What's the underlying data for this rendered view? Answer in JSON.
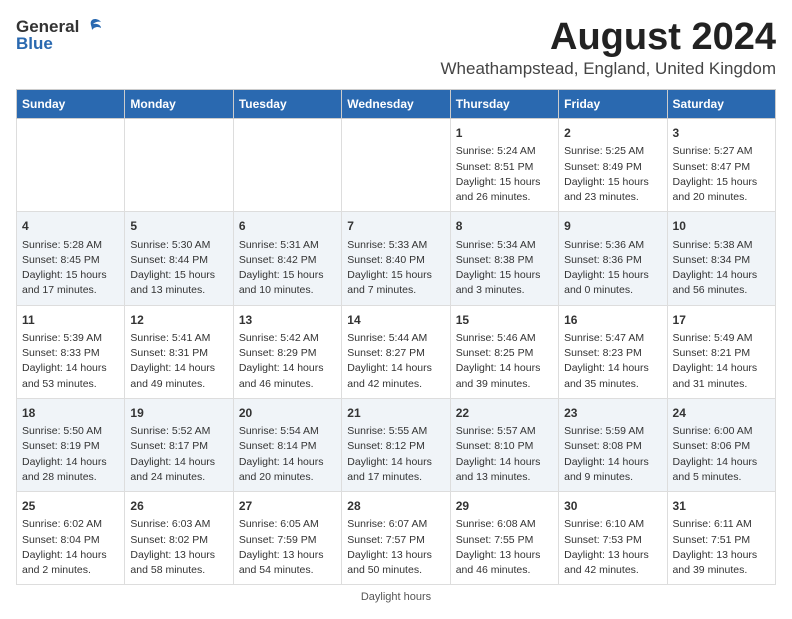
{
  "logo": {
    "general": "General",
    "blue": "Blue"
  },
  "title": "August 2024",
  "subtitle": "Wheathampstead, England, United Kingdom",
  "days_of_week": [
    "Sunday",
    "Monday",
    "Tuesday",
    "Wednesday",
    "Thursday",
    "Friday",
    "Saturday"
  ],
  "footer": "Daylight hours",
  "weeks": [
    [
      {
        "day": "",
        "data": ""
      },
      {
        "day": "",
        "data": ""
      },
      {
        "day": "",
        "data": ""
      },
      {
        "day": "",
        "data": ""
      },
      {
        "day": "1",
        "data": "Sunrise: 5:24 AM\nSunset: 8:51 PM\nDaylight: 15 hours\nand 26 minutes."
      },
      {
        "day": "2",
        "data": "Sunrise: 5:25 AM\nSunset: 8:49 PM\nDaylight: 15 hours\nand 23 minutes."
      },
      {
        "day": "3",
        "data": "Sunrise: 5:27 AM\nSunset: 8:47 PM\nDaylight: 15 hours\nand 20 minutes."
      }
    ],
    [
      {
        "day": "4",
        "data": "Sunrise: 5:28 AM\nSunset: 8:45 PM\nDaylight: 15 hours\nand 17 minutes."
      },
      {
        "day": "5",
        "data": "Sunrise: 5:30 AM\nSunset: 8:44 PM\nDaylight: 15 hours\nand 13 minutes."
      },
      {
        "day": "6",
        "data": "Sunrise: 5:31 AM\nSunset: 8:42 PM\nDaylight: 15 hours\nand 10 minutes."
      },
      {
        "day": "7",
        "data": "Sunrise: 5:33 AM\nSunset: 8:40 PM\nDaylight: 15 hours\nand 7 minutes."
      },
      {
        "day": "8",
        "data": "Sunrise: 5:34 AM\nSunset: 8:38 PM\nDaylight: 15 hours\nand 3 minutes."
      },
      {
        "day": "9",
        "data": "Sunrise: 5:36 AM\nSunset: 8:36 PM\nDaylight: 15 hours\nand 0 minutes."
      },
      {
        "day": "10",
        "data": "Sunrise: 5:38 AM\nSunset: 8:34 PM\nDaylight: 14 hours\nand 56 minutes."
      }
    ],
    [
      {
        "day": "11",
        "data": "Sunrise: 5:39 AM\nSunset: 8:33 PM\nDaylight: 14 hours\nand 53 minutes."
      },
      {
        "day": "12",
        "data": "Sunrise: 5:41 AM\nSunset: 8:31 PM\nDaylight: 14 hours\nand 49 minutes."
      },
      {
        "day": "13",
        "data": "Sunrise: 5:42 AM\nSunset: 8:29 PM\nDaylight: 14 hours\nand 46 minutes."
      },
      {
        "day": "14",
        "data": "Sunrise: 5:44 AM\nSunset: 8:27 PM\nDaylight: 14 hours\nand 42 minutes."
      },
      {
        "day": "15",
        "data": "Sunrise: 5:46 AM\nSunset: 8:25 PM\nDaylight: 14 hours\nand 39 minutes."
      },
      {
        "day": "16",
        "data": "Sunrise: 5:47 AM\nSunset: 8:23 PM\nDaylight: 14 hours\nand 35 minutes."
      },
      {
        "day": "17",
        "data": "Sunrise: 5:49 AM\nSunset: 8:21 PM\nDaylight: 14 hours\nand 31 minutes."
      }
    ],
    [
      {
        "day": "18",
        "data": "Sunrise: 5:50 AM\nSunset: 8:19 PM\nDaylight: 14 hours\nand 28 minutes."
      },
      {
        "day": "19",
        "data": "Sunrise: 5:52 AM\nSunset: 8:17 PM\nDaylight: 14 hours\nand 24 minutes."
      },
      {
        "day": "20",
        "data": "Sunrise: 5:54 AM\nSunset: 8:14 PM\nDaylight: 14 hours\nand 20 minutes."
      },
      {
        "day": "21",
        "data": "Sunrise: 5:55 AM\nSunset: 8:12 PM\nDaylight: 14 hours\nand 17 minutes."
      },
      {
        "day": "22",
        "data": "Sunrise: 5:57 AM\nSunset: 8:10 PM\nDaylight: 14 hours\nand 13 minutes."
      },
      {
        "day": "23",
        "data": "Sunrise: 5:59 AM\nSunset: 8:08 PM\nDaylight: 14 hours\nand 9 minutes."
      },
      {
        "day": "24",
        "data": "Sunrise: 6:00 AM\nSunset: 8:06 PM\nDaylight: 14 hours\nand 5 minutes."
      }
    ],
    [
      {
        "day": "25",
        "data": "Sunrise: 6:02 AM\nSunset: 8:04 PM\nDaylight: 14 hours\nand 2 minutes."
      },
      {
        "day": "26",
        "data": "Sunrise: 6:03 AM\nSunset: 8:02 PM\nDaylight: 13 hours\nand 58 minutes."
      },
      {
        "day": "27",
        "data": "Sunrise: 6:05 AM\nSunset: 7:59 PM\nDaylight: 13 hours\nand 54 minutes."
      },
      {
        "day": "28",
        "data": "Sunrise: 6:07 AM\nSunset: 7:57 PM\nDaylight: 13 hours\nand 50 minutes."
      },
      {
        "day": "29",
        "data": "Sunrise: 6:08 AM\nSunset: 7:55 PM\nDaylight: 13 hours\nand 46 minutes."
      },
      {
        "day": "30",
        "data": "Sunrise: 6:10 AM\nSunset: 7:53 PM\nDaylight: 13 hours\nand 42 minutes."
      },
      {
        "day": "31",
        "data": "Sunrise: 6:11 AM\nSunset: 7:51 PM\nDaylight: 13 hours\nand 39 minutes."
      }
    ]
  ]
}
